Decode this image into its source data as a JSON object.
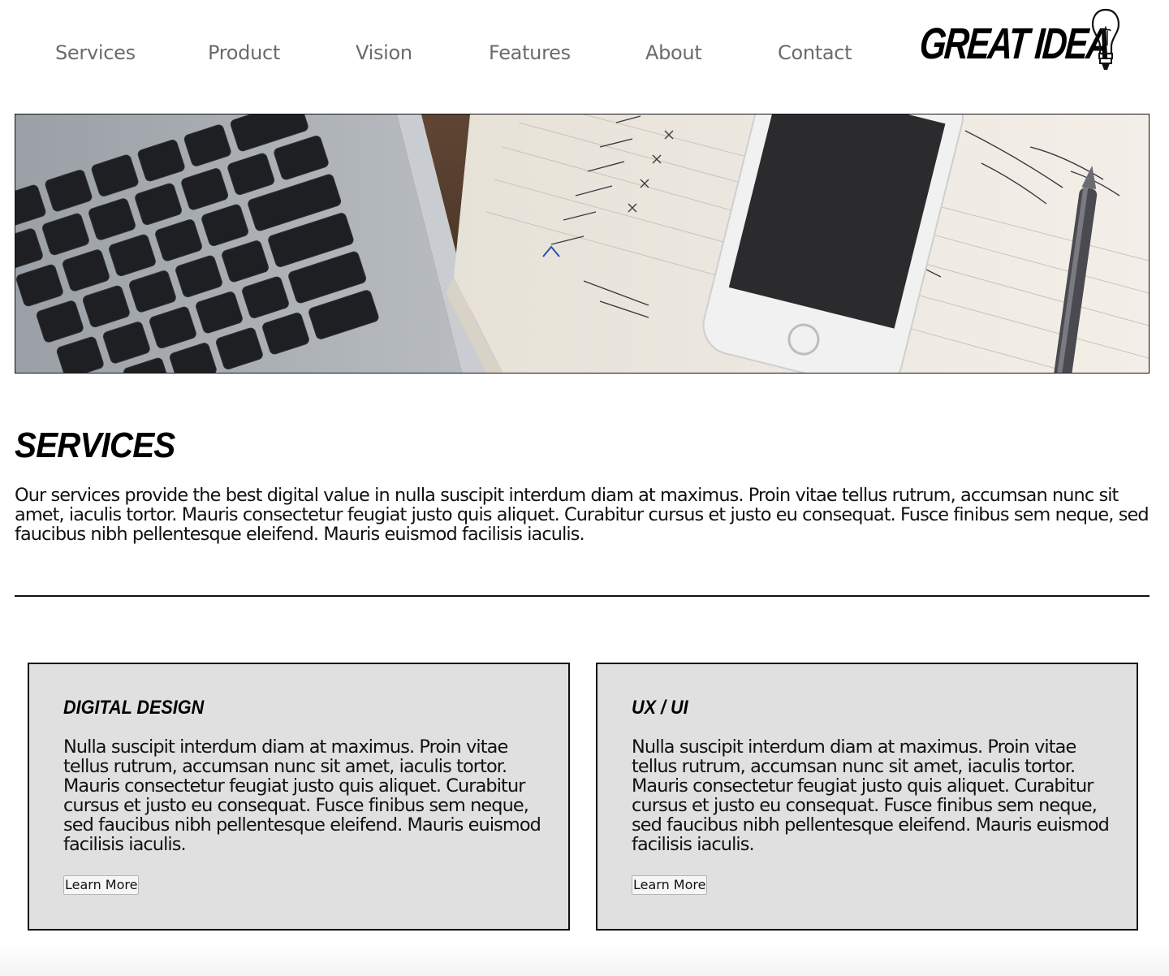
{
  "nav": {
    "items": [
      {
        "label": "Services"
      },
      {
        "label": "Product"
      },
      {
        "label": "Vision"
      },
      {
        "label": "Features"
      },
      {
        "label": "About"
      },
      {
        "label": "Contact"
      }
    ],
    "logo_text": "GREAT IDEA",
    "logo_icon": "lightbulb-icon"
  },
  "hero": {
    "image_kind": "photo: laptop keyboard, smartphone and handwritten notebook on wooden desk"
  },
  "services": {
    "title": "Services",
    "description": "Our services provide the best digital value in nulla suscipit interdum diam at maximus. Proin vitae tellus rutrum, accumsan nunc sit amet, iaculis tortor. Mauris consectetur feugiat justo quis aliquet. Curabitur cursus et justo eu consequat. Fusce finibus sem neque, sed faucibus nibh pellentesque eleifend. Mauris euismod facilisis iaculis."
  },
  "cards": [
    {
      "title": "Digital Design",
      "text": "Nulla suscipit interdum diam at maximus. Proin vitae tellus rutrum, accumsan nunc sit amet, iaculis tortor. Mauris consectetur feugiat justo quis aliquet. Curabitur cursus et justo eu consequat. Fusce finibus sem neque, sed faucibus nibh pellentesque eleifend. Mauris euismod facilisis iaculis.",
      "button": "Learn More"
    },
    {
      "title": "UX / UI",
      "text": "Nulla suscipit interdum diam at maximus. Proin vitae tellus rutrum, accumsan nunc sit amet, iaculis tortor. Mauris consectetur feugiat justo quis aliquet. Curabitur cursus et justo eu consequat. Fusce finibus sem neque, sed faucibus nibh pellentesque eleifend. Mauris euismod facilisis iaculis.",
      "button": "Learn More"
    }
  ],
  "colors": {
    "nav_text": "#6b6b6b",
    "card_bg": "#e0e0e0",
    "border": "#111111"
  }
}
